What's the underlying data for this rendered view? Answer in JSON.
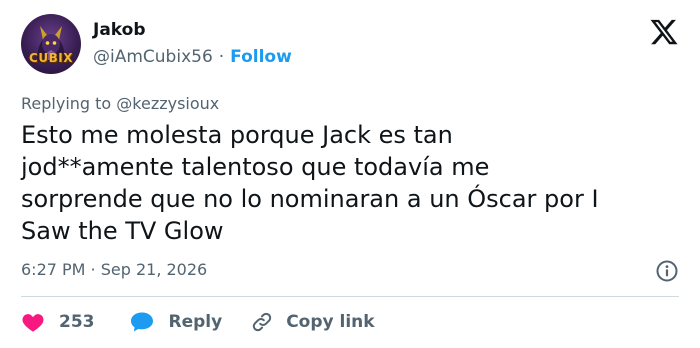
{
  "author": {
    "display_name": "Jakob",
    "handle": "@iAmCubix56",
    "separator": "·",
    "follow_label": "Follow",
    "avatar_text": "CUBIX"
  },
  "tweet": {
    "replying_to": "Replying to @kezzysioux",
    "text": "Esto me molesta porque Jack es tan\njod**amente talentoso que todavía me\nsorprende que no lo nominaran a un Óscar por I\n Saw the TV Glow",
    "timestamp": "6:27 PM · Sep 21, 2026"
  },
  "actions": {
    "like_count": "253",
    "reply_label": "Reply",
    "copy_link_label": "Copy link"
  },
  "colors": {
    "text": "#0f1419",
    "secondary": "#536471",
    "accent": "#1d9bf0",
    "like": "#f91880",
    "divider": "#cfd9de"
  },
  "icons": {
    "brand": "x-logo-icon",
    "info": "info-icon",
    "like": "heart-icon",
    "reply": "speech-bubble-icon",
    "copy": "link-icon"
  }
}
